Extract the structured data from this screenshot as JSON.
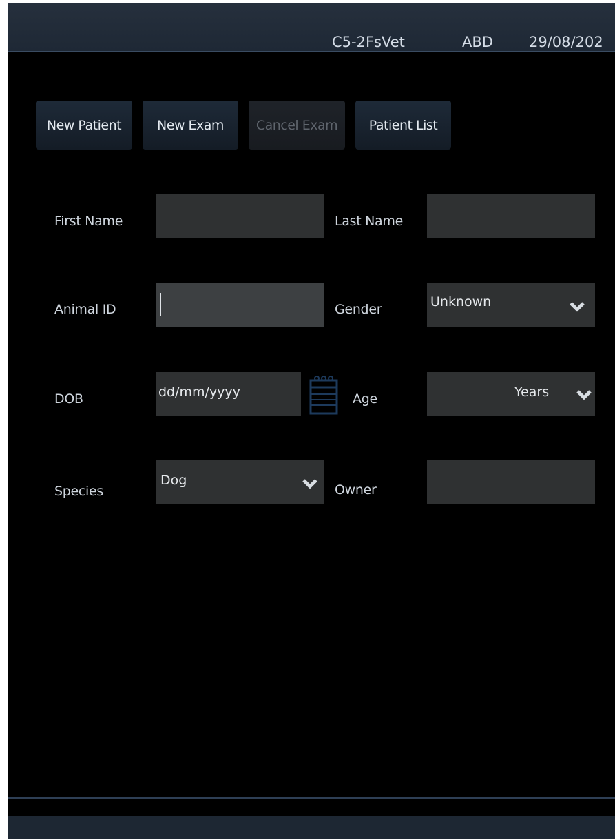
{
  "header": {
    "probe": "C5-2FsVet",
    "preset": "ABD",
    "date": "29/08/202"
  },
  "toolbar": {
    "new_patient": "New Patient",
    "new_exam": "New Exam",
    "cancel_exam": "Cancel Exam",
    "patient_list": "Patient List"
  },
  "form": {
    "first_name": {
      "label": "First Name",
      "value": ""
    },
    "last_name": {
      "label": "Last Name",
      "value": ""
    },
    "animal_id": {
      "label": "Animal ID",
      "value": ""
    },
    "gender": {
      "label": "Gender",
      "value": "Unknown"
    },
    "dob": {
      "label": "DOB",
      "placeholder": "dd/mm/yyyy"
    },
    "age": {
      "label": "Age",
      "unit": "Years",
      "value": ""
    },
    "species": {
      "label": "Species",
      "value": "Dog"
    },
    "owner": {
      "label": "Owner",
      "value": ""
    }
  },
  "icons": {
    "calendar": "calendar-icon",
    "dropdown": "chevron-down-icon"
  },
  "colors": {
    "background": "#000000",
    "header_bar": "#222c39",
    "button": "#1a2430",
    "field": "#2f3132",
    "calendar_icon": "#1d3a5c"
  }
}
